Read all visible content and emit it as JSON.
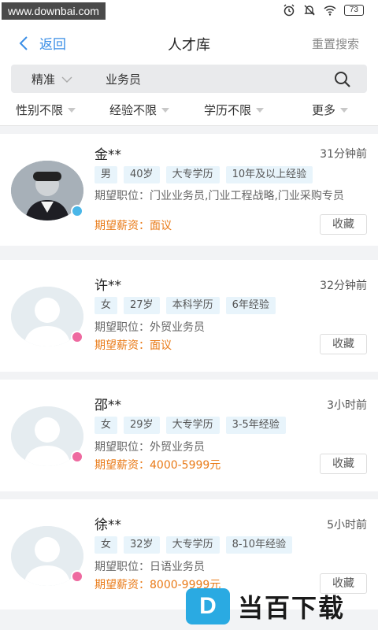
{
  "status_bar": {
    "watermark": "www.downbai.com",
    "battery": "73"
  },
  "header": {
    "back_label": "返回",
    "title": "人才库",
    "reset_label": "重置搜索"
  },
  "search": {
    "mode": "精准",
    "query": "业务员"
  },
  "filters": [
    {
      "label": "性别不限"
    },
    {
      "label": "经验不限"
    },
    {
      "label": "学历不限"
    },
    {
      "label": "更多"
    }
  ],
  "labels": {
    "position_prefix": "期望职位：",
    "salary_prefix": "期望薪资：",
    "favorite": "收藏"
  },
  "candidates": [
    {
      "name": "金**",
      "time": "31分钟前",
      "gender": "male",
      "tags": [
        "男",
        "40岁",
        "大专学历",
        "10年及以上经验"
      ],
      "position_text": "期望职位：门业业务员,门业工程战略,门业采购专员",
      "salary_text": "期望薪资：面议",
      "favorite": "收藏"
    },
    {
      "name": "许**",
      "time": "32分钟前",
      "gender": "female",
      "tags": [
        "女",
        "27岁",
        "本科学历",
        "6年经验"
      ],
      "position_text": "期望职位：外贸业务员",
      "salary_text": "期望薪资：面议",
      "favorite": "收藏"
    },
    {
      "name": "邵**",
      "time": "3小时前",
      "gender": "female",
      "tags": [
        "女",
        "29岁",
        "大专学历",
        "3-5年经验"
      ],
      "position_text": "期望职位：外贸业务员",
      "salary_text": "期望薪资：4000-5999元",
      "favorite": "收藏"
    },
    {
      "name": "徐**",
      "time": "5小时前",
      "gender": "female",
      "tags": [
        "女",
        "32岁",
        "大专学历",
        "8-10年经验"
      ],
      "position_text": "期望职位：日语业务员",
      "salary_text": "期望薪资：8000-9999元",
      "favorite": "收藏"
    }
  ],
  "watermark_logo": {
    "letter": "D",
    "text": "当百下载"
  },
  "colors": {
    "accent": "#3a8ee6",
    "salary": "#e97a17",
    "tag_bg": "#e8f4fb",
    "male": "#4ab6e8",
    "female": "#ee6aa0"
  }
}
